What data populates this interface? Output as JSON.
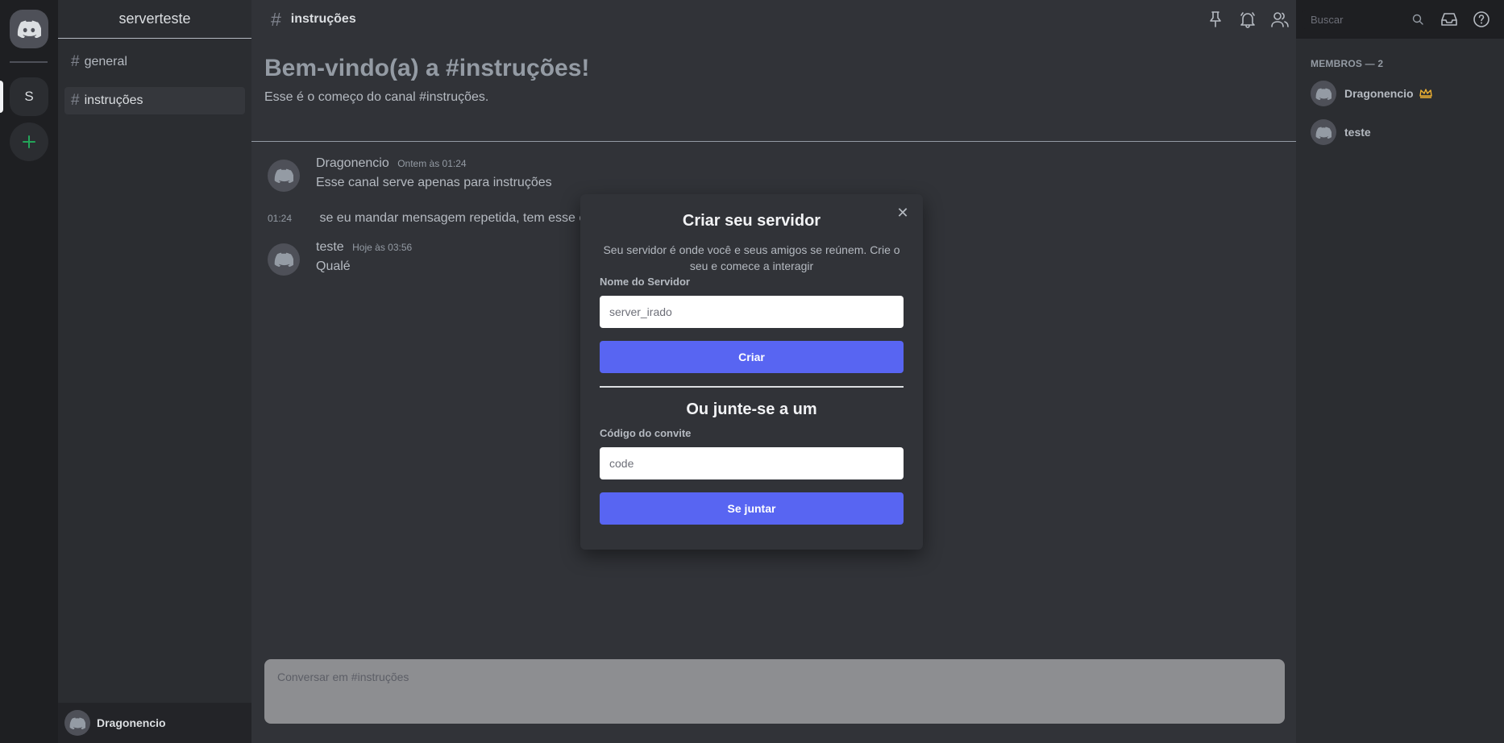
{
  "server_rail": {
    "server_initial": "S"
  },
  "guild": {
    "name": "serverteste"
  },
  "channels": [
    {
      "name": "general"
    },
    {
      "name": "instruções"
    }
  ],
  "user_panel": {
    "username": "Dragonencio"
  },
  "topbar": {
    "channel_name": "instruções",
    "search_placeholder": "Buscar"
  },
  "welcome": {
    "title": "Bem-vindo(a) a #instruções!",
    "subtitle": "Esse é o começo do canal #instruções."
  },
  "messages": [
    {
      "author": "Dragonencio",
      "timestamp": "Ontem às 01:24",
      "text": "Esse canal serve apenas para instruções"
    },
    {
      "timestamp": "01:24",
      "text": "se eu mandar mensagem repetida, tem esse ef"
    },
    {
      "author": "teste",
      "timestamp": "Hoje às 03:56",
      "text": "Qualé"
    }
  ],
  "composer": {
    "placeholder": "Conversar em #instruções"
  },
  "members": {
    "header": "MEMBROS — 2",
    "list": [
      {
        "name": "Dragonencio",
        "owner": true
      },
      {
        "name": "teste",
        "owner": false
      }
    ]
  },
  "modal": {
    "title": "Criar seu servidor",
    "description": "Seu servidor é onde você e seus amigos se reúnem. Crie o seu e comece a interagir",
    "server_name_label": "Nome do Servidor",
    "server_name_placeholder": "server_irado",
    "create_button": "Criar",
    "join_title": "Ou junte-se a um",
    "invite_label": "Código do convite",
    "invite_placeholder": "code",
    "join_button": "Se juntar"
  },
  "colors": {
    "accent": "#5865f2",
    "add_server": "#23a559",
    "owner_crown": "#f0b232"
  }
}
